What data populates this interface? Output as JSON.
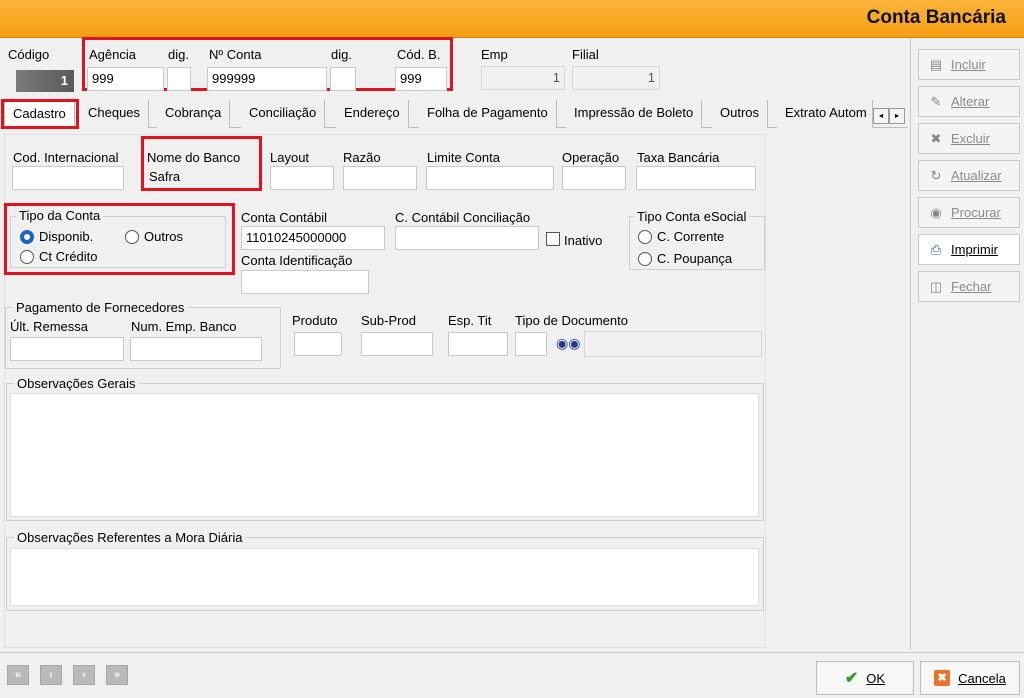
{
  "window": {
    "title": "Conta Bancária"
  },
  "header": {
    "codigo_label": "Código",
    "codigo_value": "1",
    "agencia_label": "Agência",
    "agencia_value": "999",
    "dig_label": "dig.",
    "agencia_dig_value": "",
    "conta_label": "Nº Conta",
    "conta_value": "999999",
    "conta_dig_label": "dig.",
    "conta_dig_value": "",
    "codb_label": "Cód. B.",
    "codb_value": "999",
    "emp_label": "Emp",
    "emp_value": "1",
    "filial_label": "Filial",
    "filial_value": "1"
  },
  "tabs": [
    "Cadastro",
    "Cheques",
    "Cobrança",
    "Conciliação",
    "Endereço",
    "Folha de Pagamento",
    "Impressão de Boleto",
    "Outros",
    "Extrato Autom"
  ],
  "cadastro": {
    "cod_internacional_label": "Cod. Internacional",
    "cod_internacional_value": "",
    "nome_banco_label": "Nome do Banco",
    "nome_banco_value": "Safra",
    "layout_label": "Layout",
    "razao_label": "Razão",
    "limite_label": "Limite Conta",
    "operacao_label": "Operação",
    "taxa_label": "Taxa Bancária",
    "tipo_conta_title": "Tipo da Conta",
    "tipo_conta_options": [
      "Disponib.",
      "Outros",
      "Ct Crédito"
    ],
    "tipo_conta_selected": "Disponib.",
    "conta_contabil_label": "Conta Contábil",
    "conta_contabil_value": "11010245000000",
    "conta_conciliacao_label": "C. Contábil Conciliação",
    "inativo_label": "Inativo",
    "conta_identificacao_label": "Conta Identificação",
    "esocial_title": "Tipo Conta eSocial",
    "esocial_options": [
      "C. Corrente",
      "C. Poupança"
    ],
    "pagamento_title": "Pagamento de Fornecedores",
    "ult_remessa_label": "Últ. Remessa",
    "num_emp_banco_label": "Num. Emp. Banco",
    "produto_label": "Produto",
    "subprod_label": "Sub-Prod",
    "esp_tit_label": "Esp. Tit",
    "tipo_documento_label": "Tipo de Documento",
    "obs_gerais_title": "Observações Gerais",
    "obs_mora_title": "Observações Referentes a Mora Diária"
  },
  "sidebar": {
    "buttons": [
      {
        "label": "Incluir",
        "icon": "document-icon",
        "enabled": false
      },
      {
        "label": "Alterar",
        "icon": "edit-icon",
        "enabled": false
      },
      {
        "label": "Excluir",
        "icon": "delete-icon",
        "enabled": false
      },
      {
        "label": "Atualizar",
        "icon": "refresh-icon",
        "enabled": false
      },
      {
        "label": "Procurar",
        "icon": "binoculars-icon",
        "enabled": false
      },
      {
        "label": "Imprimir",
        "icon": "printer-icon",
        "enabled": true
      },
      {
        "label": "Fechar",
        "icon": "close-folder-icon",
        "enabled": false
      }
    ]
  },
  "footer": {
    "ok_label": "OK",
    "cancel_label": "Cancela"
  },
  "colors": {
    "accent": "#f7a521",
    "highlight": "#e0141e",
    "radio_selected": "#1a63c8"
  }
}
